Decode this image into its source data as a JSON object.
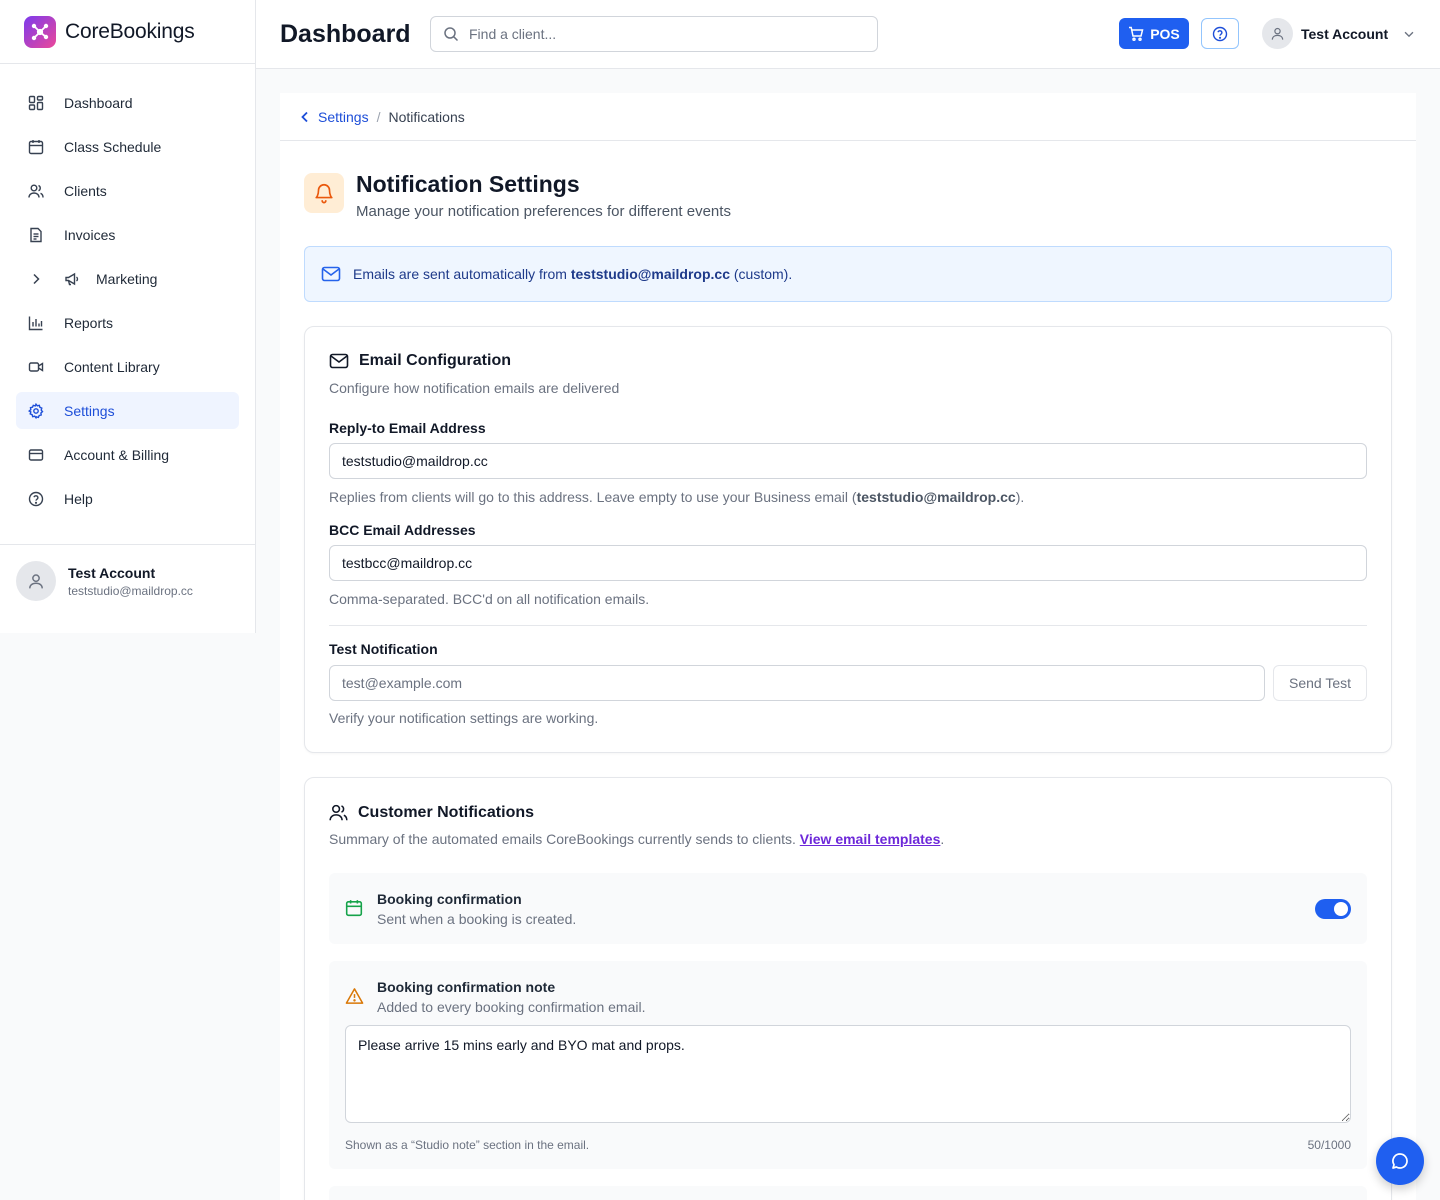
{
  "brand": {
    "name": "CoreBookings"
  },
  "sidebar": {
    "items": [
      {
        "label": "Dashboard"
      },
      {
        "label": "Class Schedule"
      },
      {
        "label": "Clients"
      },
      {
        "label": "Invoices"
      },
      {
        "label": "Marketing"
      },
      {
        "label": "Reports"
      },
      {
        "label": "Content Library"
      },
      {
        "label": "Settings"
      },
      {
        "label": "Account & Billing"
      },
      {
        "label": "Help"
      }
    ],
    "active": "Settings",
    "user": {
      "name": "Test Account",
      "email": "teststudio@maildrop.cc"
    }
  },
  "header": {
    "title": "Dashboard",
    "search_placeholder": "Find a client...",
    "pos_label": "POS",
    "user_name": "Test Account"
  },
  "breadcrumb": {
    "parent": "Settings",
    "separator": "/",
    "current": "Notifications"
  },
  "page": {
    "title": "Notification Settings",
    "subtitle": "Manage your notification preferences for different events"
  },
  "banner": {
    "prefix": "Emails are sent automatically from ",
    "email": "teststudio@maildrop.cc",
    "suffix": " (custom)."
  },
  "email_config": {
    "title": "Email Configuration",
    "description": "Configure how notification emails are delivered",
    "reply_to": {
      "label": "Reply-to Email Address",
      "value": "teststudio@maildrop.cc",
      "help_prefix": "Replies from clients will go to this address. Leave empty to use your Business email (",
      "help_email": "teststudio@maildrop.cc",
      "help_suffix": ")."
    },
    "bcc": {
      "label": "BCC Email Addresses",
      "value": "testbcc@maildrop.cc",
      "help": "Comma-separated. BCC'd on all notification emails."
    },
    "test": {
      "label": "Test Notification",
      "placeholder": "test@example.com",
      "button": "Send Test",
      "help": "Verify your notification settings are working."
    }
  },
  "customer_notifications": {
    "title": "Customer Notifications",
    "description": "Summary of the automated emails CoreBookings currently sends to clients. ",
    "link": "View email templates",
    "link_suffix": ".",
    "booking_confirmation": {
      "title": "Booking confirmation",
      "subtitle": "Sent when a booking is created.",
      "enabled": true
    },
    "confirmation_note": {
      "title": "Booking confirmation note",
      "subtitle": "Added to every booking confirmation email.",
      "value": "Please arrive 15 mins early and BYO mat and props.",
      "help": "Shown as a “Studio note” section in the email.",
      "count": "50/1000"
    }
  },
  "colors": {
    "accent": "#1f5ff0",
    "active_nav_bg": "#eff4ff",
    "banner_bg": "#eff6ff",
    "bell_bg": "#ffedd5"
  },
  "icons": [
    "corebookings-logo",
    "dashboard-icon",
    "calendar-icon",
    "users-icon",
    "invoice-icon",
    "chevron-right-icon",
    "megaphone-icon",
    "bar-chart-icon",
    "video-icon",
    "gear-icon",
    "credit-card-icon",
    "help-circle-icon",
    "search-icon",
    "cart-icon",
    "chevron-down-icon",
    "chevron-left-icon",
    "bell-icon",
    "mail-icon",
    "warning-icon",
    "chat-icon"
  ]
}
